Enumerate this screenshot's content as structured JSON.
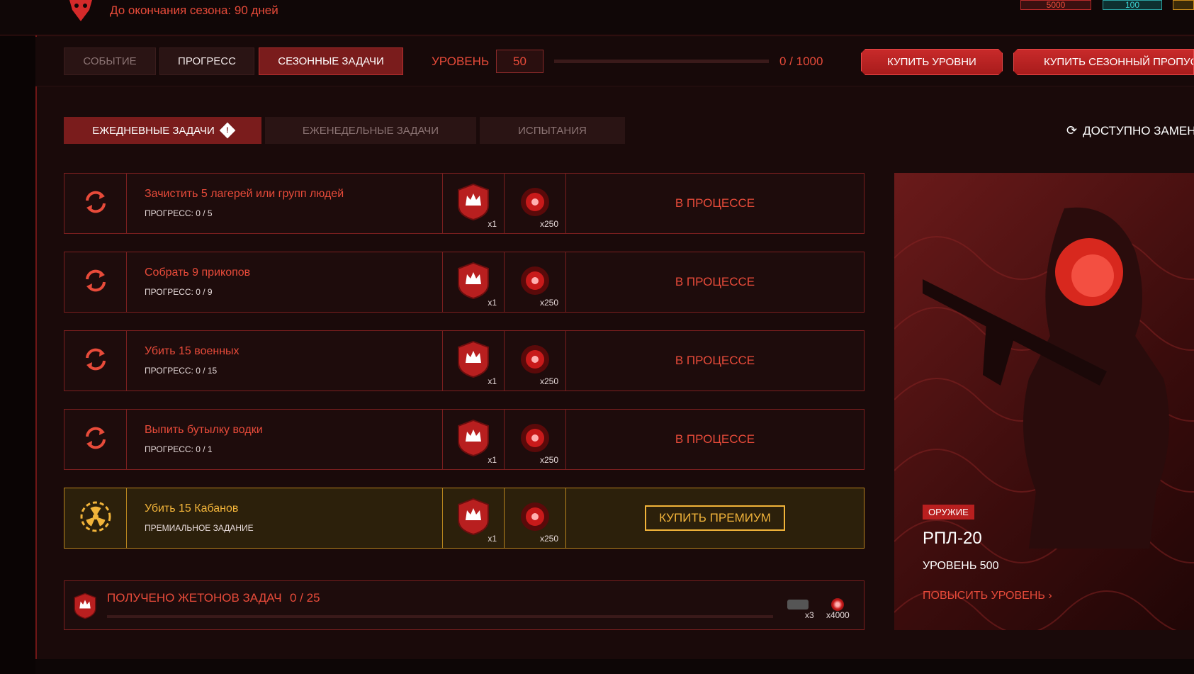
{
  "header": {
    "season_text": "До окончания сезона: 90 дней",
    "currency_red": "5000",
    "currency_blue": "100"
  },
  "nav": {
    "tabs": [
      {
        "label": "СОБЫТИЕ"
      },
      {
        "label": "ПРОГРЕСС"
      },
      {
        "label": "СЕЗОННЫЕ ЗАДАЧИ"
      }
    ],
    "level_label": "УРОВЕНЬ",
    "level_value": "50",
    "level_progress_text": "0 / 1000",
    "level_progress_fraction": 0,
    "buy_levels_label": "КУПИТЬ УРОВНИ",
    "buy_pass_label": "КУПИТЬ СЕЗОННЫЙ ПРОПУСК"
  },
  "subtabs": {
    "items": [
      {
        "label": "ЕЖЕДНЕВНЫЕ ЗАДАЧИ"
      },
      {
        "label": "ЕЖЕНЕДЕЛЬНЫЕ ЗАДАЧИ"
      },
      {
        "label": "ИСПЫТАНИЯ"
      }
    ],
    "replace_label": "ДОСТУПНО ЗАМЕН"
  },
  "tasks": [
    {
      "title": "Зачистить 5 лагерей или групп людей",
      "progress": "ПРОГРЕСС: 0 / 5",
      "token_qty": "x1",
      "orb_qty": "x250",
      "status": "В ПРОЦЕССЕ"
    },
    {
      "title": "Собрать 9 прикопов",
      "progress": "ПРОГРЕСС: 0 / 9",
      "token_qty": "x1",
      "orb_qty": "x250",
      "status": "В ПРОЦЕССЕ"
    },
    {
      "title": "Убить 15 военных",
      "progress": "ПРОГРЕСС: 0 / 15",
      "token_qty": "x1",
      "orb_qty": "x250",
      "status": "В ПРОЦЕССЕ"
    },
    {
      "title": "Выпить бутылку водки",
      "progress": "ПРОГРЕСС: 0 / 1",
      "token_qty": "x1",
      "orb_qty": "x250",
      "status": "В ПРОЦЕССЕ"
    }
  ],
  "premium_task": {
    "title": "Убить 15 Кабанов",
    "subtitle": "ПРЕМИАЛЬНОЕ ЗАДАНИЕ",
    "token_qty": "x1",
    "orb_qty": "x250",
    "button_label": "КУПИТЬ ПРЕМИУМ"
  },
  "tokens": {
    "label": "ПОЛУЧЕНО ЖЕТОНОВ ЗАДАЧ",
    "count": "0 / 25",
    "progress_fraction": 0,
    "reward1_qty": "x3",
    "reward2_qty": "x4000"
  },
  "promo": {
    "badge": "ОРУЖИЕ",
    "name": "РПЛ-20",
    "level": "УРОВЕНЬ 500",
    "link": "ПОВЫСИТЬ УРОВЕНЬ"
  },
  "colors": {
    "accent": "#e84b3a",
    "gold": "#f2b43a",
    "bg": "#1a0a0a"
  }
}
